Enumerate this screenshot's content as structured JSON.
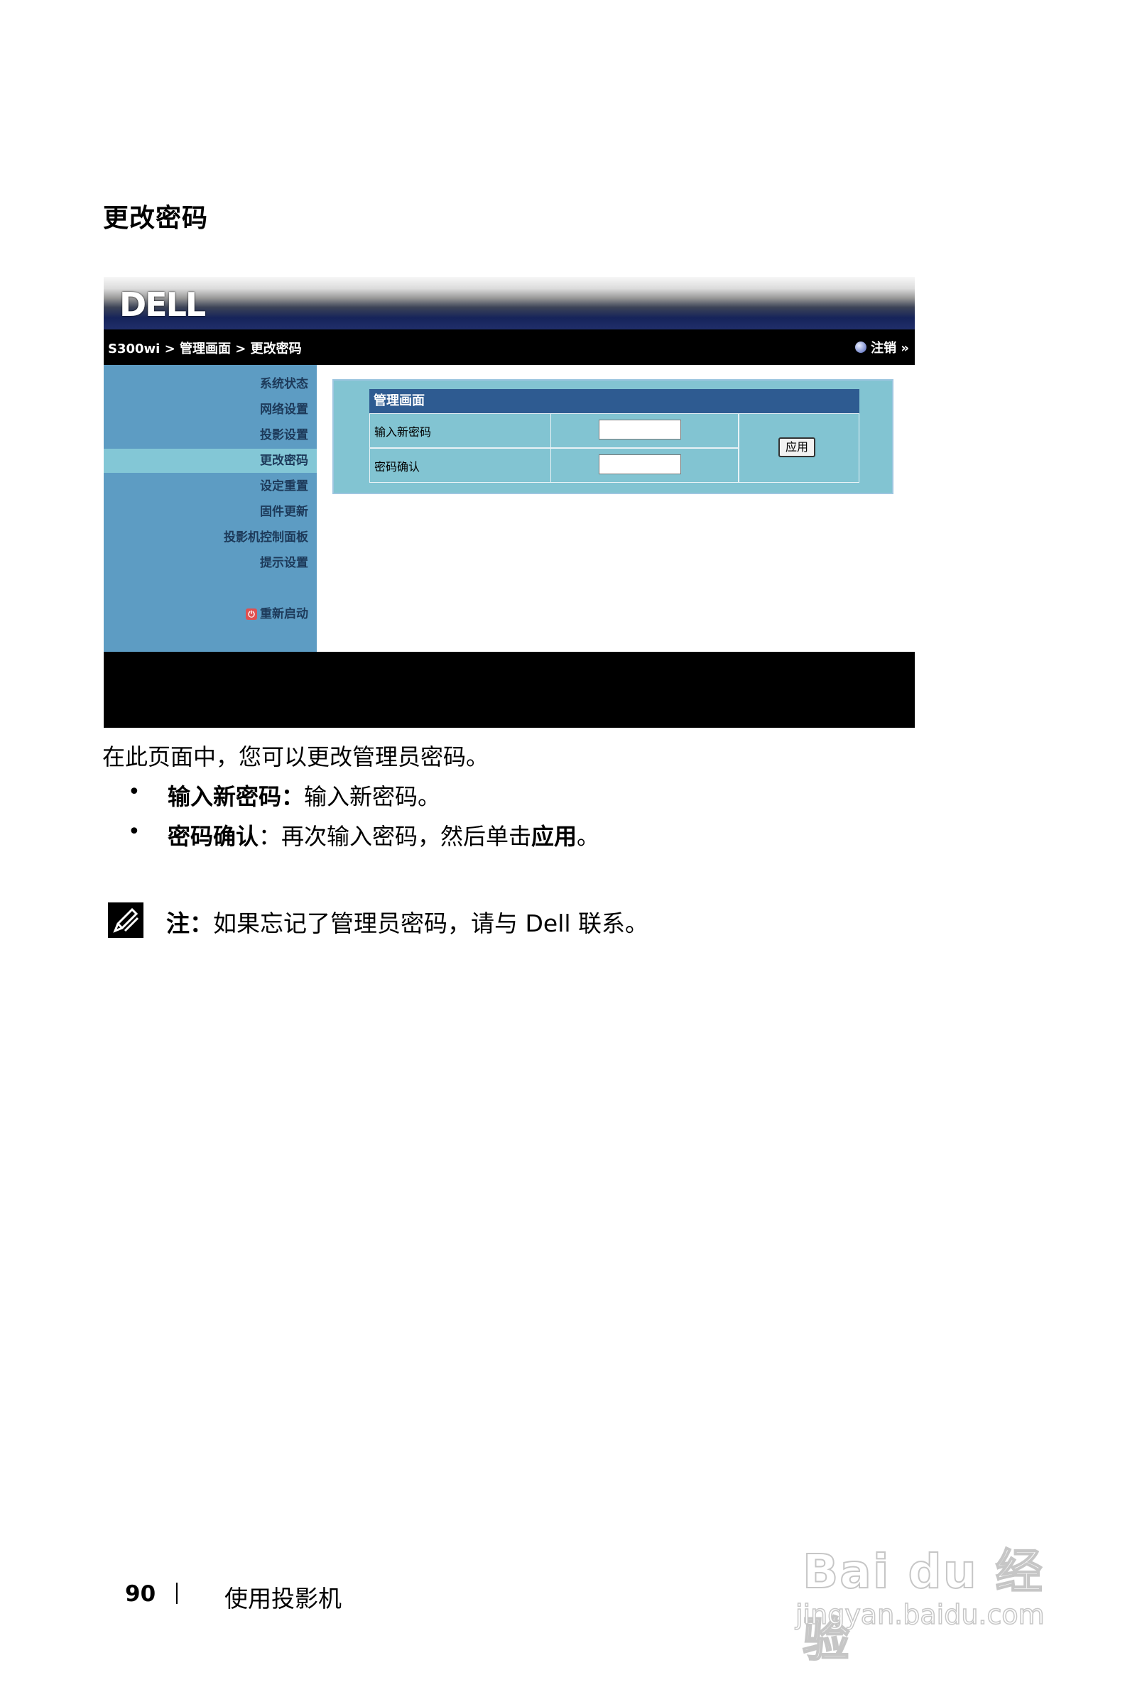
{
  "section_title": "更改密码",
  "screenshot": {
    "brand": "DELL",
    "breadcrumb": "S300wi > 管理画面 > 更改密码",
    "logout_label": "注销 »",
    "sidebar": [
      {
        "label": "系统状态",
        "active": false
      },
      {
        "label": "网络设置",
        "active": false
      },
      {
        "label": "投影设置",
        "active": false
      },
      {
        "label": "更改密码",
        "active": true
      },
      {
        "label": "设定重置",
        "active": false
      },
      {
        "label": "固件更新",
        "active": false
      },
      {
        "label": "投影机控制面板",
        "active": false
      },
      {
        "label": "提示设置",
        "active": false
      }
    ],
    "reboot_label": "重新启动",
    "panel_title": "管理画面",
    "fields": [
      {
        "label": "输入新密码",
        "value": ""
      },
      {
        "label": "密码确认",
        "value": ""
      }
    ],
    "apply_label": "应用"
  },
  "body": {
    "intro": "在此页面中，您可以更改管理员密码。",
    "bullets": [
      {
        "term": "输入新密码：",
        "text": "输入新密码。"
      },
      {
        "term": "密码确认",
        "text": "：再次输入密码，然后单击",
        "term2": "应用",
        "tail": "。"
      }
    ],
    "note_label": "注：",
    "note_text": "如果忘记了管理员密码，请与 Dell 联系。"
  },
  "footer": {
    "page_number": "90",
    "running_head": "使用投影机"
  },
  "watermark": {
    "main": "Bai du 经验",
    "sub": "jingyan.baidu.com"
  }
}
